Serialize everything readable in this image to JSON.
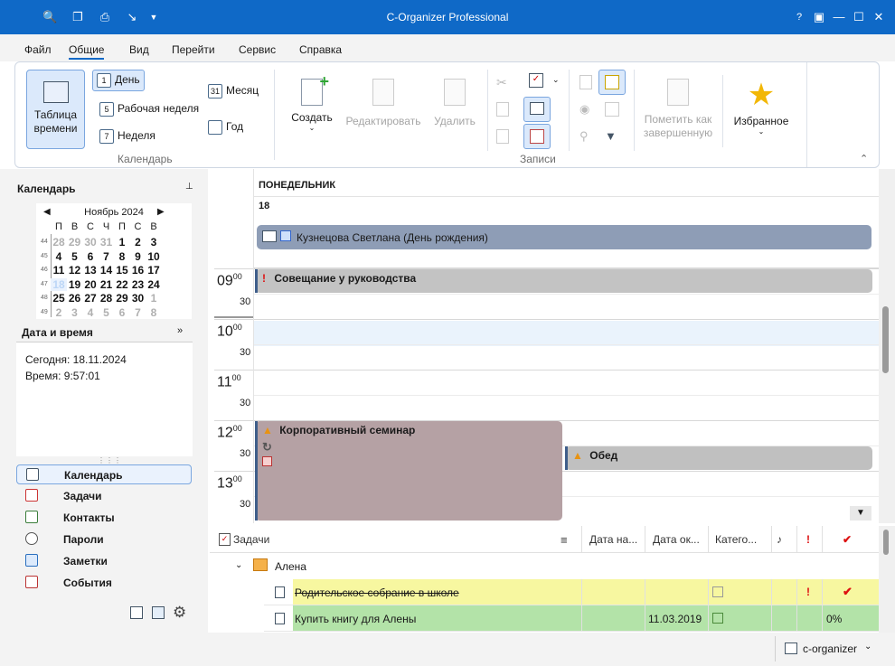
{
  "window": {
    "title": "C-Organizer Professional"
  },
  "menu": [
    "Файл",
    "Общие",
    "Вид",
    "Перейти",
    "Сервис",
    "Справка"
  ],
  "ribbon": {
    "timetable": "Таблица времени",
    "day": "День",
    "workweek": "Рабочая неделя",
    "week": "Неделя",
    "month": "Месяц",
    "year": "Год",
    "group_calendar": "Календарь",
    "create": "Создать",
    "edit": "Редактировать",
    "delete": "Удалить",
    "mark_done": "Пометить как завершенную",
    "favorites": "Избранное",
    "group_records": "Записи",
    "icon_day": "1",
    "icon_workweek": "5",
    "icon_week": "7",
    "icon_month": "31"
  },
  "sidebar": {
    "calendar_title": "Календарь",
    "month_label": "Ноябрь 2024",
    "weekdays": [
      "П",
      "В",
      "С",
      "Ч",
      "П",
      "С",
      "В"
    ],
    "weeks": [
      {
        "num": "44",
        "days": [
          "28",
          "29",
          "30",
          "31",
          "1",
          "2",
          "3"
        ],
        "prev": [
          true,
          true,
          true,
          true,
          false,
          false,
          false
        ]
      },
      {
        "num": "45",
        "days": [
          "4",
          "5",
          "6",
          "7",
          "8",
          "9",
          "10"
        ],
        "prev": [
          false,
          false,
          false,
          false,
          false,
          false,
          false
        ]
      },
      {
        "num": "46",
        "days": [
          "11",
          "12",
          "13",
          "14",
          "15",
          "16",
          "17"
        ],
        "prev": [
          false,
          false,
          false,
          false,
          false,
          false,
          false
        ]
      },
      {
        "num": "47",
        "days": [
          "18",
          "19",
          "20",
          "21",
          "22",
          "23",
          "24"
        ],
        "prev": [
          false,
          false,
          false,
          false,
          false,
          false,
          false
        ]
      },
      {
        "num": "48",
        "days": [
          "25",
          "26",
          "27",
          "28",
          "29",
          "30",
          "1"
        ],
        "prev": [
          false,
          false,
          false,
          false,
          false,
          false,
          true
        ]
      },
      {
        "num": "49",
        "days": [
          "2",
          "3",
          "4",
          "5",
          "6",
          "7",
          "8"
        ],
        "prev": [
          true,
          true,
          true,
          true,
          true,
          true,
          true
        ]
      }
    ],
    "datetime_title": "Дата и время",
    "today": "Сегодня: 18.11.2024",
    "time": "Время: 9:57:01",
    "nav": [
      "Календарь",
      "Задачи",
      "Контакты",
      "Пароли",
      "Заметки",
      "События"
    ]
  },
  "day_view": {
    "weekday": "ПОНЕДЕЛЬНИК",
    "date": "18",
    "allday_event": "Кузнецова Светлана (День рождения)",
    "hours": [
      "09",
      "10",
      "11",
      "12",
      "13"
    ],
    "minute_label": "00",
    "half_label": "30",
    "events": {
      "meeting": "Совещание у руководства",
      "seminar": "Корпоративный семинар",
      "lunch": "Обед"
    },
    "colors": {
      "allday": "#8e9db6",
      "meeting": "#c3c3c3",
      "seminar": "#b5a1a4",
      "lunch": "#c0c0c0",
      "accent": "#3f5e8a"
    }
  },
  "tasks": {
    "title": "Задачи",
    "columns": [
      "Дата на...",
      "Дата ок...",
      "Катего..."
    ],
    "group": "Алена",
    "rows": [
      {
        "name": "Родительское собрание в школе",
        "due": "",
        "progress": "",
        "color": "#f7f7a0"
      },
      {
        "name": "Купить книгу для Алены",
        "due": "11.03.2019",
        "progress": "0%",
        "color": "#b3e3a8"
      }
    ]
  },
  "statusbar": {
    "profile": "c-organizer"
  }
}
